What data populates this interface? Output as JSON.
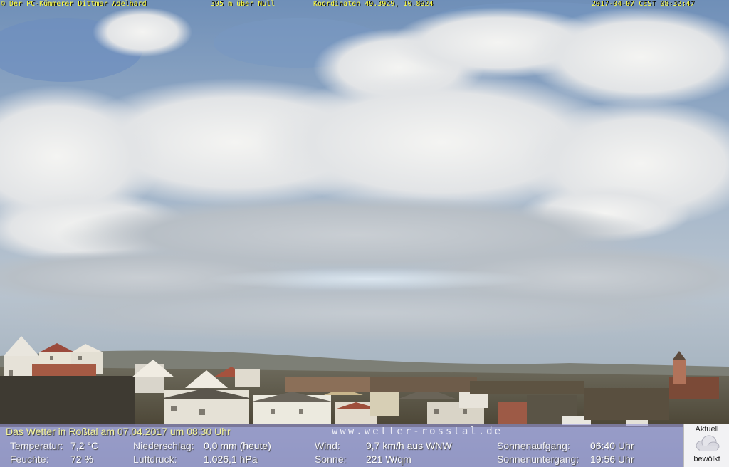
{
  "header": {
    "operator": "© Der PC-Kümmerer Dittmar Adelhard",
    "altitude": "395 m über Null",
    "coordinates": "Koordinaten 49.3929, 10.8924",
    "timestamp": "2017-04-07 CEST 08:32:47"
  },
  "weather": {
    "title": "Das Wetter in Roßtal am 07.04.2017 um 08:30 Uhr",
    "website": "www.wetter-rosstal.de",
    "temperature_label": "Temperatur:",
    "temperature_value": "7,2 °C",
    "humidity_label": "Feuchte:",
    "humidity_value": "72 %",
    "precip_label": "Niederschlag:",
    "precip_value": "0,0 mm (heute)",
    "pressure_label": "Luftdruck:",
    "pressure_value": "1.026,1 hPa",
    "wind_label": "Wind:",
    "wind_value": "9,7 km/h aus WNW",
    "sun_label": "Sonne:",
    "sun_value": "221 W/qm",
    "sunrise_label": "Sonnenaufgang:",
    "sunrise_value": "06:40 Uhr",
    "sunset_label": "Sonnenuntergang:",
    "sunset_value": "19:56 Uhr"
  },
  "current": {
    "heading": "Aktuell",
    "condition": "bewölkt",
    "icon": "cloud-icon"
  },
  "colors": {
    "header_text": "#ffff44",
    "panel_bg": "#9696d7",
    "title_text": "#f4f49c"
  }
}
